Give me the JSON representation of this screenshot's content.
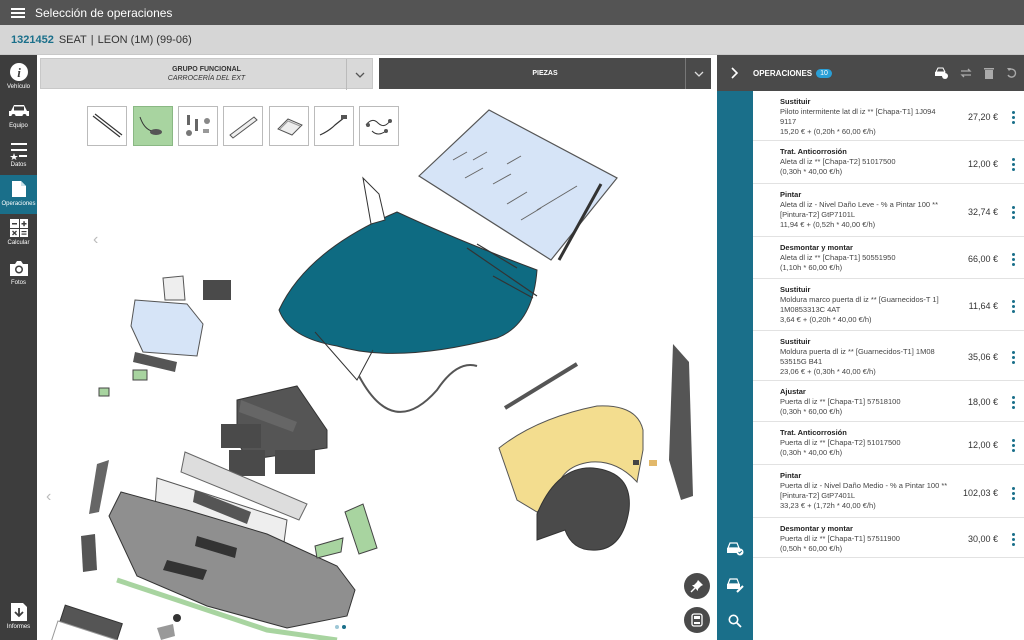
{
  "topbar": {
    "title": "Selección de operaciones"
  },
  "vehicle": {
    "code": "1321452",
    "make": "SEAT",
    "separator": "|",
    "model": "LEON (1M) (99-06)"
  },
  "leftnav": {
    "items": [
      {
        "label": "Vehículo",
        "icon": "info-icon"
      },
      {
        "label": "Equipo",
        "icon": "car-icon"
      },
      {
        "label": "Datos",
        "icon": "list-star-icon"
      },
      {
        "label": "Operaciones",
        "icon": "hand-icon",
        "active": true
      },
      {
        "label": "Calcular",
        "icon": "calculator-icon"
      },
      {
        "label": "Fotos",
        "icon": "camera-icon"
      },
      {
        "label": "Informes",
        "icon": "download-icon"
      }
    ]
  },
  "dropdowns": {
    "grupo": {
      "label": "GRUPO FUNCIONAL",
      "value": "CARROCERÍA DEL EXT"
    },
    "piezas": {
      "label": "PIEZAS"
    }
  },
  "panel": {
    "title": "OPERACIONES",
    "count": "10",
    "operations": [
      {
        "type": "Sustituir",
        "desc": "Piloto intermitente lat dl iz ** [Chapa-T1] 1J094 9117",
        "calc": "15,20 € + (0,20h * 60,00 €/h)",
        "price": "27,20 €"
      },
      {
        "type": "Trat. Anticorrosión",
        "desc": "Aleta dl iz ** [Chapa-T2] 51017500",
        "calc": "(0,30h * 40,00 €/h)",
        "price": "12,00 €"
      },
      {
        "type": "Pintar",
        "desc": "Aleta dl iz - Nivel Daño Leve - % a Pintar 100 ** [Pintura-T2] GtP7101L",
        "calc": "11,94 € + (0,52h * 40,00 €/h)",
        "price": "32,74 €"
      },
      {
        "type": "Desmontar y montar",
        "desc": "Aleta dl iz ** [Chapa-T1] 50551950",
        "calc": "(1,10h * 60,00 €/h)",
        "price": "66,00 €"
      },
      {
        "type": "Sustituir",
        "desc": "Moldura marco puerta dl iz ** [Guarnecidos-T 1] 1M0853313C 4AT",
        "calc": "3,64 € + (0,20h * 40,00 €/h)",
        "price": "11,64 €"
      },
      {
        "type": "Sustituir",
        "desc": "Moldura puerta dl iz ** [Guarnecidos-T1] 1M08 53515G B41",
        "calc": "23,06 € + (0,30h * 40,00 €/h)",
        "price": "35,06 €"
      },
      {
        "type": "Ajustar",
        "desc": "Puerta dl iz ** [Chapa-T1] 57518100",
        "calc": "(0,30h * 60,00 €/h)",
        "price": "18,00 €"
      },
      {
        "type": "Trat. Anticorrosión",
        "desc": "Puerta dl iz ** [Chapa-T2] 51017500",
        "calc": "(0,30h * 40,00 €/h)",
        "price": "12,00 €"
      },
      {
        "type": "Pintar",
        "desc": "Puerta dl iz - Nivel Daño Medio - % a Pintar 100 ** [Pintura-T2] GtP7401L",
        "calc": "33,23 € + (1,72h * 40,00 €/h)",
        "price": "102,03 €"
      },
      {
        "type": "Desmontar y montar",
        "desc": "Puerta dl iz ** [Chapa-T1] 57511900",
        "calc": "(0,50h * 60,00 €/h)",
        "price": "30,00 €"
      }
    ]
  },
  "colors": {
    "accent": "#1a6f8a",
    "hood": "#0e6b82",
    "fender": "#f3dd8f",
    "windshield": "#d6e4f7",
    "selected_parts": "#a8d4a0",
    "badge": "#2a9fd6"
  }
}
